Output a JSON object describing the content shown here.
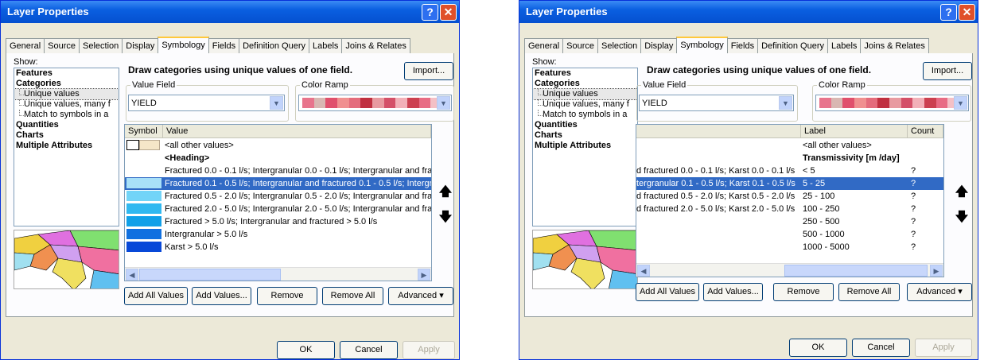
{
  "dialog": {
    "title": "Layer Properties",
    "tabs": [
      "General",
      "Source",
      "Selection",
      "Display",
      "Symbology",
      "Fields",
      "Definition Query",
      "Labels",
      "Joins & Relates"
    ],
    "active_tab": "Symbology",
    "show_label": "Show:",
    "show_items": [
      {
        "label": "Features",
        "kind": "bold"
      },
      {
        "label": "Categories",
        "kind": "bold"
      },
      {
        "label": "Unique values",
        "kind": "sub"
      },
      {
        "label": "Unique values, many f",
        "kind": "sub"
      },
      {
        "label": "Match to symbols in a",
        "kind": "sub"
      },
      {
        "label": "Quantities",
        "kind": "bold"
      },
      {
        "label": "Charts",
        "kind": "bold"
      },
      {
        "label": "Multiple Attributes",
        "kind": "bold"
      }
    ],
    "description": "Draw categories using unique values of one field.",
    "import_label": "Import...",
    "value_field_label": "Value Field",
    "value_field": "YIELD",
    "color_ramp_label": "Color Ramp",
    "ramp_colors": [
      "#e8748c",
      "#d9b7b2",
      "#e0506c",
      "#f09090",
      "#e46c7c",
      "#c03040",
      "#e89aa0",
      "#d45068",
      "#f2b0b8",
      "#cc4050",
      "#e86c84",
      "#f4c0c6"
    ],
    "buttons": {
      "add_all": "Add All Values",
      "add": "Add Values...",
      "remove": "Remove",
      "remove_all": "Remove All",
      "advanced": "Advanced",
      "ok": "OK",
      "cancel": "Cancel",
      "apply": "Apply"
    },
    "up_icon": "arrow-up-icon",
    "down_icon": "arrow-down-icon"
  },
  "left": {
    "columns": [
      "Symbol",
      "Value"
    ],
    "rows": [
      {
        "value": "<all other values>",
        "color": "#f5e6c8",
        "bordered": true
      },
      {
        "value": "<Heading>",
        "color": "",
        "heading": true
      },
      {
        "value": "Fractured 0.0 - 0.1 l/s; Intergranular 0.0 - 0.1 l/s; Intergranular and fractu",
        "color": "#ffffff"
      },
      {
        "value": "Fractured 0.1 - 0.5 l/s; Intergranular and fractured 0.1 - 0.5 l/s; Intergran",
        "color": "#a8e0f8",
        "selected": true
      },
      {
        "value": "Fractured 0.5 - 2.0 l/s; Intergranular 0.5 - 2.0 l/s; Intergranular and fractu",
        "color": "#72d4f8"
      },
      {
        "value": "Fractured 2.0 - 5.0 l/s; Intergranular 2.0 - 5.0 l/s; Intergranular and fractu",
        "color": "#30b8f0"
      },
      {
        "value": "Fractured > 5.0 l/s; Intergranular and fractured > 5.0 l/s",
        "color": "#10a0e8"
      },
      {
        "value": "Intergranular > 5.0 l/s",
        "color": "#1070e0"
      },
      {
        "value": "Karst > 5.0 l/s",
        "color": "#0848d8"
      }
    ]
  },
  "right": {
    "columns": [
      "Label",
      "Count"
    ],
    "rows": [
      {
        "value": "",
        "label": "<all other values>",
        "count": ""
      },
      {
        "value": "",
        "label": "Transmissivity [m  /day]",
        "count": "",
        "heading": true
      },
      {
        "value": "d fractured 0.0 - 0.1 l/s; Karst 0.0 - 0.1 l/s",
        "label": "< 5",
        "count": "?"
      },
      {
        "value": "tergranular 0.1 - 0.5 l/s; Karst 0.1 - 0.5 l/s",
        "label": "5 - 25",
        "count": "?",
        "selected": true
      },
      {
        "value": "d fractured 0.5 - 2.0 l/s; Karst 0.5 - 2.0 l/s",
        "label": "25 - 100",
        "count": "?"
      },
      {
        "value": "d fractured 2.0 - 5.0 l/s; Karst 2.0 - 5.0 l/s",
        "label": "100 - 250",
        "count": "?"
      },
      {
        "value": "",
        "label": "250 - 500",
        "count": "?"
      },
      {
        "value": "",
        "label": "500 - 1000",
        "count": "?"
      },
      {
        "value": "",
        "label": "1000 - 5000",
        "count": "?"
      }
    ]
  }
}
